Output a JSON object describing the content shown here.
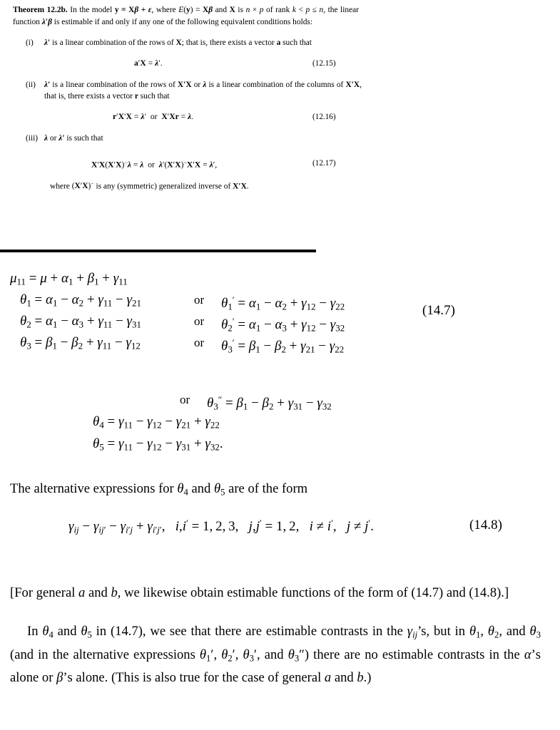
{
  "document": {
    "theorem": {
      "label": "Theorem 12.2b.",
      "intro_1": "In the model ",
      "model_eq": "y = Xβ + ε",
      "intro_2": ", where ",
      "expectation_eq": "E(y) = Xβ",
      "intro_3": " and ",
      "matrix_X": "X",
      "intro_4": " is ",
      "dims": "n × p",
      "line2_a": "of rank ",
      "rank_cond": "k < p ≤ n",
      "line2_b": ", the linear function ",
      "lin_fn": "λ′β",
      "line2_c": " is estimable if and only if any one of",
      "line3": "the following equivalent conditions holds:",
      "conditions": [
        {
          "num": "(i)",
          "text_a": "λ′",
          "text_b": " is a linear combination of the rows of ",
          "text_c": "X",
          "text_d": "; that is, there exists a vector ",
          "text_e": "a",
          "text_f": " such that",
          "equation": "a′X = λ′.",
          "eqno": "(12.15)"
        },
        {
          "num": "(ii)",
          "text_a": "λ′",
          "text_b": " is a linear combination of the rows of ",
          "text_c": "X′X",
          "text_d": " or ",
          "text_e": "λ",
          "text_f": " is a linear combination of",
          "text_g": "the columns of ",
          "text_h": "X′X",
          "text_i": ", that is, there exists a vector ",
          "text_j": "r",
          "text_k": " such that",
          "equation": "r′X′X = λ′   or   X′Xr = λ.",
          "eqno": "(12.16)"
        },
        {
          "num": "(iii)",
          "text_a": "λ",
          "text_b": " or ",
          "text_c": "λ′",
          "text_d": " is such that",
          "equation": "X′X(X′X)⁻λ = λ   or   λ′(X′X)⁻X′X = λ′,",
          "eqno": "(12.17)"
        }
      ],
      "where_a": "where ",
      "where_b": "(X′X)⁻",
      "where_c": " is any (symmetric) generalized inverse of ",
      "where_d": "X′X",
      "where_e": "."
    },
    "equations_147": {
      "eqno": "(14.7)",
      "or_label": "or",
      "rows": [
        {
          "lhs": "μ11 = μ + α1 + β1 + γ11",
          "lhs_base": "μ",
          "lhs_sub": "11",
          "rhs_terms": "μ + α1 + β1 + γ11",
          "has_alt": false
        },
        {
          "lhs_base": "θ",
          "lhs_sub": "1",
          "lhs_rhs": "α1 − α2 + γ11 − γ21",
          "alt_base": "θ",
          "alt_sub": "1",
          "alt_prime": "′",
          "alt_rhs": "α1 − α2 + γ12 − γ22",
          "has_alt": true
        },
        {
          "lhs_base": "θ",
          "lhs_sub": "2",
          "lhs_rhs": "α1 − α3 + γ11 − γ31",
          "alt_base": "θ",
          "alt_sub": "2",
          "alt_prime": "′",
          "alt_rhs": "α1 − α3 + γ12 − γ32",
          "has_alt": true
        },
        {
          "lhs_base": "θ",
          "lhs_sub": "3",
          "lhs_rhs": "β1 − β2 + γ11 − γ12",
          "alt_base": "θ",
          "alt_sub": "3",
          "alt_prime": "′",
          "alt_rhs": "β1 − β2 + γ21 − γ22",
          "has_alt": true
        }
      ],
      "continuation": [
        {
          "or_label": "or",
          "base": "θ",
          "sub": "3",
          "prime": "″",
          "rhs": "β1 − β2 + γ31 − γ32"
        },
        {
          "base": "θ",
          "sub": "4",
          "rhs": "γ11 − γ12 − γ21 + γ22"
        },
        {
          "base": "θ",
          "sub": "5",
          "rhs": "γ11 − γ12 − γ31 + γ32."
        }
      ]
    },
    "alt_expr_line": {
      "text_a": "The alternative expressions for ",
      "theta4": "θ4",
      "text_b": " and ",
      "theta5": "θ5",
      "text_c": " are of the form"
    },
    "equation_148": {
      "expression": "γij − γij′ − γi′j + γi′j′,",
      "index_i": "i, i′ = 1, 2, 3,",
      "index_j": "j, j′ = 1, 2,",
      "ne_i": "i ≠ i′,",
      "ne_j": "j ≠ j′.",
      "eqno": "(14.8)"
    },
    "paragraph_1": {
      "text_a": "[For general ",
      "var_a": "a",
      "text_b": " and ",
      "var_b": "b",
      "text_c": ", we likewise obtain estimable functions of the form of (14.7) and (14.8).]"
    },
    "paragraph_2": {
      "text_a": "In ",
      "theta4": "θ4",
      "text_b": " and ",
      "theta5": "θ5",
      "text_c": " in (14.7), we see that there are estimable contrasts in the ",
      "gamma_ij": "γij",
      "text_d": "’s, but in ",
      "theta1": "θ1",
      "text_e": ", ",
      "theta2": "θ2",
      "text_f": ", and ",
      "theta3": "θ3",
      "text_g": " (and in the alternative expressions ",
      "theta1p": "θ1′",
      "theta2p": "θ2′",
      "theta3p": "θ3′",
      "theta3pp": "θ3″",
      "text_h": ", and ",
      "text_i": ") there are no estimable contrasts in the ",
      "alpha": "α",
      "text_j": "’s alone or ",
      "beta": "β",
      "text_k": "’s alone. (This is also true for the case of general ",
      "var_a": "a",
      "text_l": " and ",
      "var_b": "b",
      "text_m": ".)"
    }
  }
}
